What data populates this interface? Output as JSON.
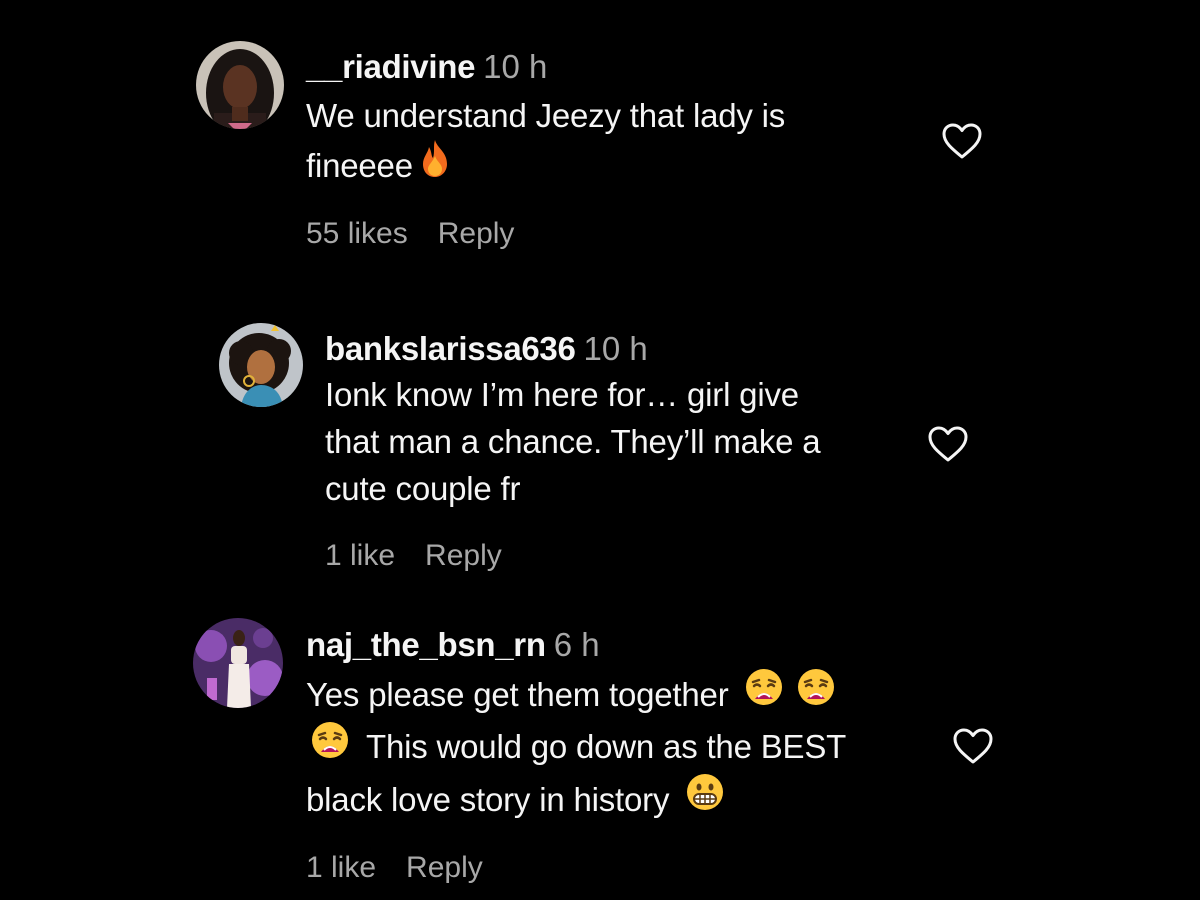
{
  "comments": [
    {
      "username": "__riadivine",
      "time": "10 h",
      "lines": [
        "We understand Jeezy that lady is",
        "fineeee"
      ],
      "emoji_names": [
        "fire-emoji"
      ],
      "likes": "55 likes",
      "reply": "Reply"
    },
    {
      "username": "bankslarissa636",
      "time": "10 h",
      "lines": [
        "Ionk know I’m here for… girl give",
        "that man a chance. They’ll make a",
        "cute couple fr"
      ],
      "likes": "1 like",
      "reply": "Reply"
    },
    {
      "username": "naj_the_bsn_rn",
      "time": "6 h",
      "lines": [
        "Yes please get them together",
        "This would go down as the BEST",
        "black love story in history"
      ],
      "emoji_names": [
        "weary-face-emoji",
        "weary-face-emoji",
        "weary-face-emoji",
        "grimacing-face-emoji"
      ],
      "likes": "1 like",
      "reply": "Reply"
    }
  ],
  "icons": {
    "like": "heart-outline-icon"
  },
  "colors": {
    "background": "#000000",
    "primary_text": "#f5f5f5",
    "secondary_text": "#a8a8a8"
  }
}
